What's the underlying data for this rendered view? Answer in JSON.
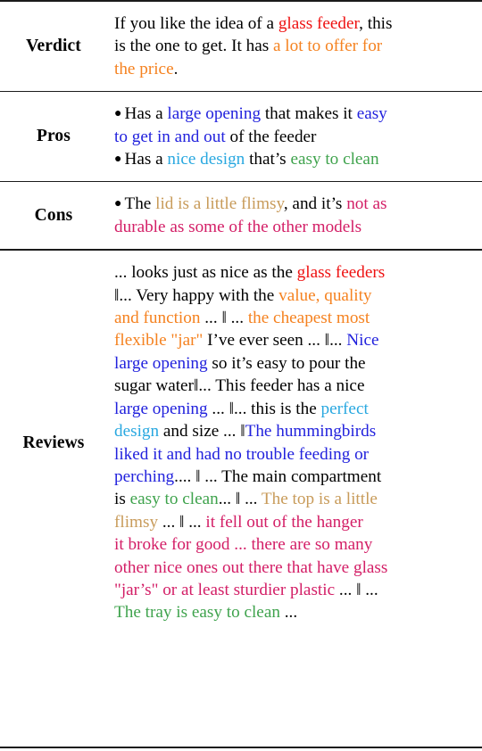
{
  "colors": {
    "black": "#000000",
    "red": "#EE1111",
    "orange": "#F58220",
    "blue": "#2222DD",
    "cyan": "#29A8E0",
    "green": "#3FA34D",
    "tan": "#C89B5A",
    "crimson": "#D31E66",
    "rule": "#1b1b1b"
  },
  "rows": [
    {
      "label": "Verdict",
      "kind": "paragraph",
      "lines": [
        [
          {
            "t": "If you like the idea of a ",
            "c": "black"
          },
          {
            "t": "glass feeder",
            "c": "red"
          },
          {
            "t": ", this",
            "c": "black"
          }
        ],
        [
          {
            "t": "is the one to get. It has ",
            "c": "black"
          },
          {
            "t": "a lot to offer for",
            "c": "orange"
          }
        ],
        [
          {
            "t": "the price",
            "c": "orange"
          },
          {
            "t": ".",
            "c": "black"
          }
        ]
      ]
    },
    {
      "label": "Pros",
      "kind": "bullets",
      "bullets": [
        {
          "lines": [
            [
              {
                "t": "Has a ",
                "c": "black"
              },
              {
                "t": "large opening",
                "c": "blue"
              },
              {
                "t": " that makes it ",
                "c": "black"
              },
              {
                "t": "easy",
                "c": "blue"
              }
            ],
            [
              {
                "t": "to get in and out",
                "c": "blue"
              },
              {
                "t": " of the feeder",
                "c": "black"
              }
            ]
          ]
        },
        {
          "lines": [
            [
              {
                "t": "Has a ",
                "c": "black"
              },
              {
                "t": "nice design",
                "c": "cyan"
              },
              {
                "t": " that’s ",
                "c": "black"
              },
              {
                "t": "easy to clean",
                "c": "green"
              }
            ]
          ]
        }
      ]
    },
    {
      "label": "Cons",
      "kind": "bullets",
      "bullets": [
        {
          "lines": [
            [
              {
                "t": "The ",
                "c": "black"
              },
              {
                "t": "lid is a little flimsy",
                "c": "tan"
              },
              {
                "t": ", and it’s ",
                "c": "black"
              },
              {
                "t": "not as",
                "c": "crimson"
              }
            ],
            [
              {
                "t": "durable as some of the other models",
                "c": "crimson"
              }
            ]
          ]
        }
      ]
    },
    {
      "label": "Reviews",
      "kind": "paragraph",
      "lines": [
        [
          {
            "t": "... looks just as nice as the ",
            "c": "black"
          },
          {
            "t": "glass feeders",
            "c": "red"
          }
        ],
        [
          {
            "t": "‖... Very happy with the ",
            "c": "black"
          },
          {
            "t": "value, quality",
            "c": "orange"
          }
        ],
        [
          {
            "t": "and function",
            "c": "orange"
          },
          {
            "t": " ... ‖ ... ",
            "c": "black"
          },
          {
            "t": "the cheapest most",
            "c": "orange"
          }
        ],
        [
          {
            "t": "flexible \"jar\"",
            "c": "orange"
          },
          {
            "t": " I’ve ever seen ... ‖... ",
            "c": "black"
          },
          {
            "t": "Nice",
            "c": "blue"
          }
        ],
        [
          {
            "t": "large opening",
            "c": "blue"
          },
          {
            "t": " so it’s easy to pour the",
            "c": "black"
          }
        ],
        [
          {
            "t": "sugar water",
            "c": "black"
          },
          {
            "t": "‖... This feeder has a nice",
            "c": "black"
          }
        ],
        [
          {
            "t": "large opening",
            "c": "blue"
          },
          {
            "t": " ... ‖... this is the ",
            "c": "black"
          },
          {
            "t": "perfect",
            "c": "cyan"
          }
        ],
        [
          {
            "t": "design",
            "c": "cyan"
          },
          {
            "t": " and size ... ‖",
            "c": "black"
          },
          {
            "t": "The hummingbirds",
            "c": "blue"
          }
        ],
        [
          {
            "t": "liked it and had no trouble feeding or",
            "c": "blue"
          }
        ],
        [
          {
            "t": "perching",
            "c": "blue"
          },
          {
            "t": ".... ‖ ... The main compartment",
            "c": "black"
          }
        ],
        [
          {
            "t": "is ",
            "c": "black"
          },
          {
            "t": "easy to clean",
            "c": "green"
          },
          {
            "t": "... ‖ ... ",
            "c": "black"
          },
          {
            "t": "The top is a little",
            "c": "tan"
          }
        ],
        [
          {
            "t": "flimsy",
            "c": "tan"
          },
          {
            "t": " ... ‖ ... ",
            "c": "black"
          },
          {
            "t": "it fell out of the hanger",
            "c": "crimson"
          }
        ],
        [
          {
            "t": "it broke for good ...  there are so many",
            "c": "crimson"
          }
        ],
        [
          {
            "t": "other nice ones out there that have glass",
            "c": "crimson"
          }
        ],
        [
          {
            "t": "\"jar’s\" or at least sturdier plastic",
            "c": "crimson"
          },
          {
            "t": " ... ‖ ...",
            "c": "black"
          }
        ],
        [
          {
            "t": "The tray is easy to clean",
            "c": "green"
          },
          {
            "t": " ...",
            "c": "black"
          }
        ]
      ]
    }
  ]
}
